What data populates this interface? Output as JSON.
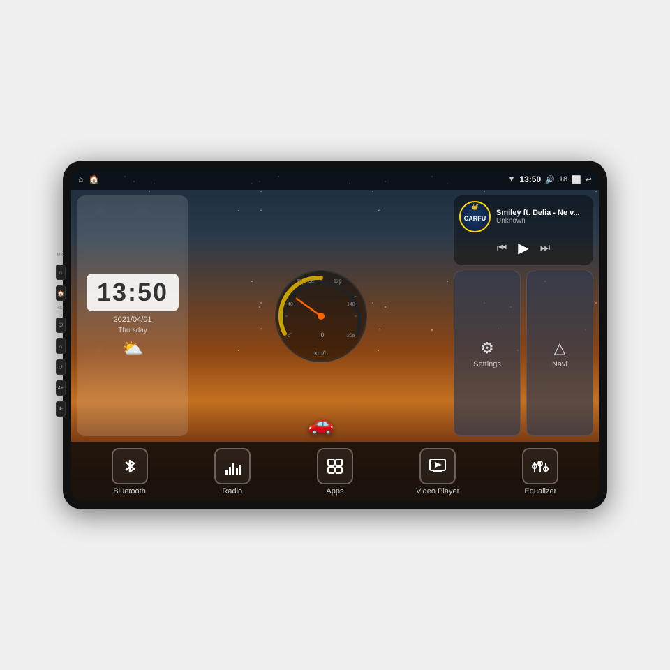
{
  "device": {
    "title": "Car Head Unit"
  },
  "status_bar": {
    "left_icons": [
      "⌂",
      "🏠"
    ],
    "time": "13:50",
    "volume": "18",
    "signal_icon": "▼",
    "battery_icon": "⬜",
    "back_icon": "↩"
  },
  "clock": {
    "time": "13:50",
    "date": "2021/04/01",
    "day": "Thursday"
  },
  "weather": {
    "icon": "⛅"
  },
  "speedometer": {
    "value": "0",
    "unit": "km/h",
    "max": 240
  },
  "music": {
    "title": "Smiley ft. Delia - Ne v...",
    "artist": "Unknown",
    "logo_text": "CARFU",
    "controls": {
      "prev": "⏮",
      "play": "▶",
      "next": "⏭"
    }
  },
  "quick_buttons": [
    {
      "id": "settings",
      "label": "Settings",
      "icon": "⚙"
    },
    {
      "id": "navi",
      "label": "Navi",
      "icon": "🧭"
    }
  ],
  "app_bar": [
    {
      "id": "bluetooth",
      "label": "Bluetooth",
      "icon": "Ᵽ"
    },
    {
      "id": "radio",
      "label": "Radio",
      "icon": "📊"
    },
    {
      "id": "apps",
      "label": "Apps",
      "icon": "⊞"
    },
    {
      "id": "video-player",
      "label": "Video Player",
      "icon": "▶"
    },
    {
      "id": "equalizer",
      "label": "Equalizer",
      "icon": "⚡"
    }
  ],
  "side_panel": {
    "items": [
      "MIC",
      "RST",
      "⏻",
      "⌂",
      "↺",
      "4+",
      "4-"
    ]
  }
}
